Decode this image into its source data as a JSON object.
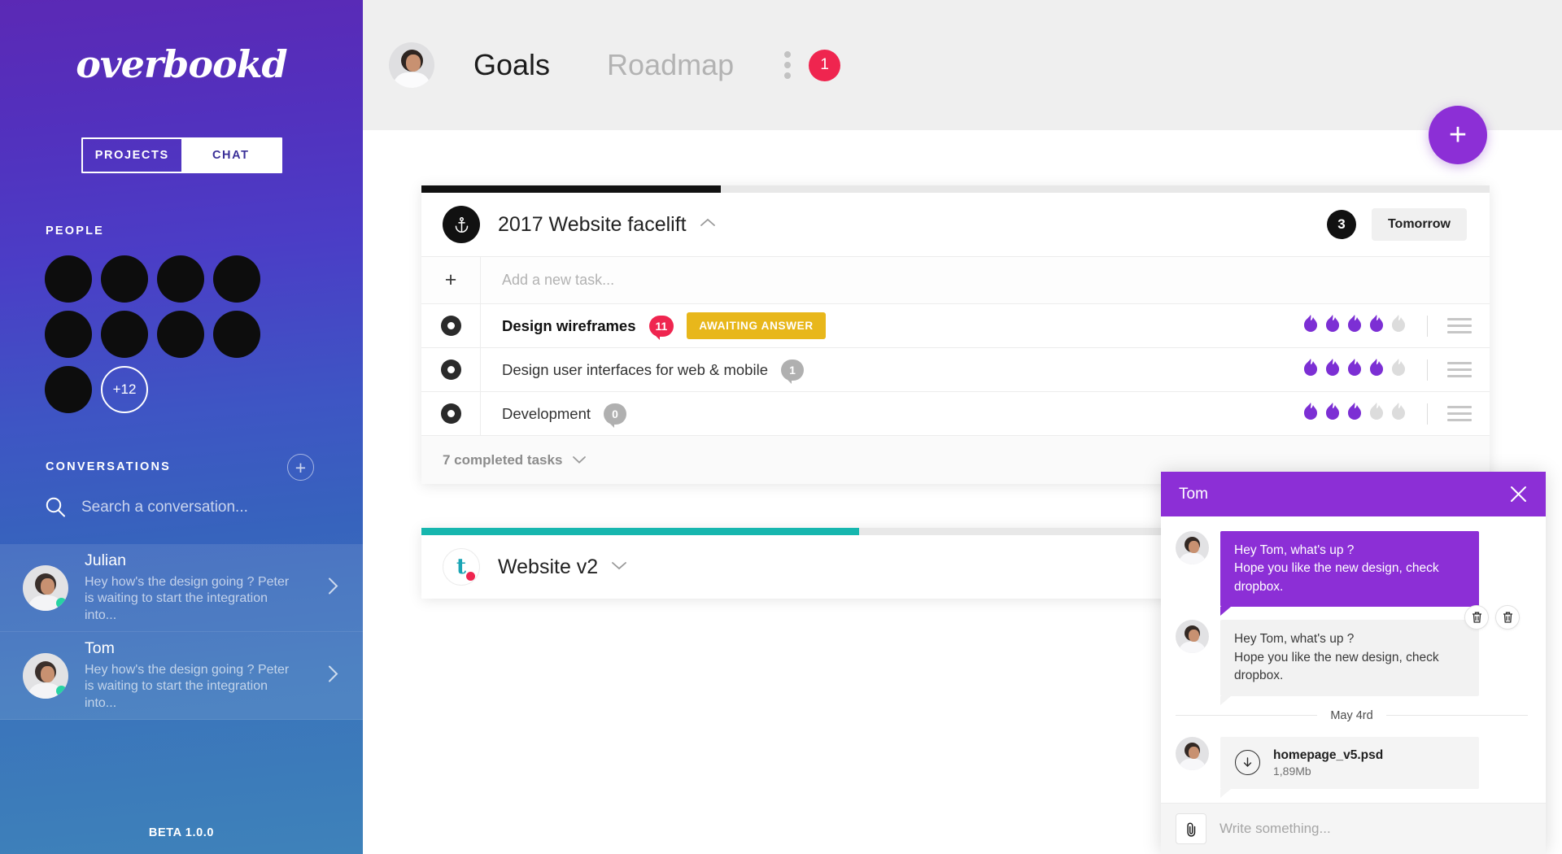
{
  "sidebar": {
    "logo": "overbookd",
    "toggle": {
      "projects": "PROJECTS",
      "chat": "CHAT"
    },
    "people": {
      "label": "PEOPLE",
      "avatar_count": 9,
      "more_label": "+12"
    },
    "conversations": {
      "label": "CONVERSATIONS",
      "add_icon": "plus-icon",
      "search_placeholder": "Search a conversation...",
      "search_value": "",
      "items": [
        {
          "name": "Julian",
          "preview": "Hey how's the design going ? Peter is waiting to start the integration into...",
          "online": true
        },
        {
          "name": "Tom",
          "preview": "Hey how's the design going ? Peter is waiting to start the integration into...",
          "online": true
        }
      ]
    },
    "beta": "BETA 1.0.0"
  },
  "topbar": {
    "avatar": "user-avatar",
    "tabs": [
      {
        "label": "Goals",
        "active": true
      },
      {
        "label": "Roadmap",
        "active": false
      }
    ],
    "menu_icon": "kebab-menu-icon",
    "badge": "1",
    "fab_label": "+"
  },
  "board": {
    "cards": [
      {
        "title": "2017 Website facelift",
        "icon": "anchor-icon",
        "progress_color": "#111111",
        "progress_pct": 28,
        "count": "3",
        "due": "Tomorrow",
        "add_task_placeholder": "Add a new task...",
        "add_task_value": "",
        "tasks": [
          {
            "name": "Design wireframes",
            "bold": true,
            "badge": "11",
            "badge_style": "pink",
            "tag": "AWAITING ANSWER",
            "flames_on": 4,
            "flames_total": 5
          },
          {
            "name": "Design user interfaces for web & mobile",
            "bold": false,
            "badge": "1",
            "badge_style": "gray",
            "tag": "",
            "flames_on": 4,
            "flames_total": 5
          },
          {
            "name": "Development",
            "bold": false,
            "badge": "0",
            "badge_style": "gray",
            "tag": "",
            "flames_on": 3,
            "flames_total": 5
          }
        ],
        "completed_label": "7 completed tasks"
      },
      {
        "title": "Website v2",
        "icon": "t-logo-icon",
        "progress_color": "#16b6ae",
        "progress_pct": 41
      }
    ]
  },
  "chat": {
    "title": "Tom",
    "close_icon": "close-icon",
    "messages": [
      {
        "style": "purple",
        "lines": [
          "Hey Tom, what's up ?",
          "Hope you like the new design, check dropbox."
        ]
      },
      {
        "style": "grey",
        "lines": [
          "Hey Tom, what's up ?",
          "Hope you like the new design, check dropbox."
        ],
        "actions": [
          "trash-icon",
          "trash-icon"
        ]
      }
    ],
    "date_divider": "May 4rd",
    "attachment": {
      "name": "homepage_v5.psd",
      "size": "1,89Mb",
      "icon": "download-icon"
    },
    "input_placeholder": "Write something...",
    "input_value": "",
    "attach_icon": "paperclip-icon"
  },
  "colors": {
    "accent_purple": "#8c2fd6",
    "badge_pink": "#ef254f",
    "tag_yellow": "#e8b71b",
    "teal": "#16b6ae"
  }
}
